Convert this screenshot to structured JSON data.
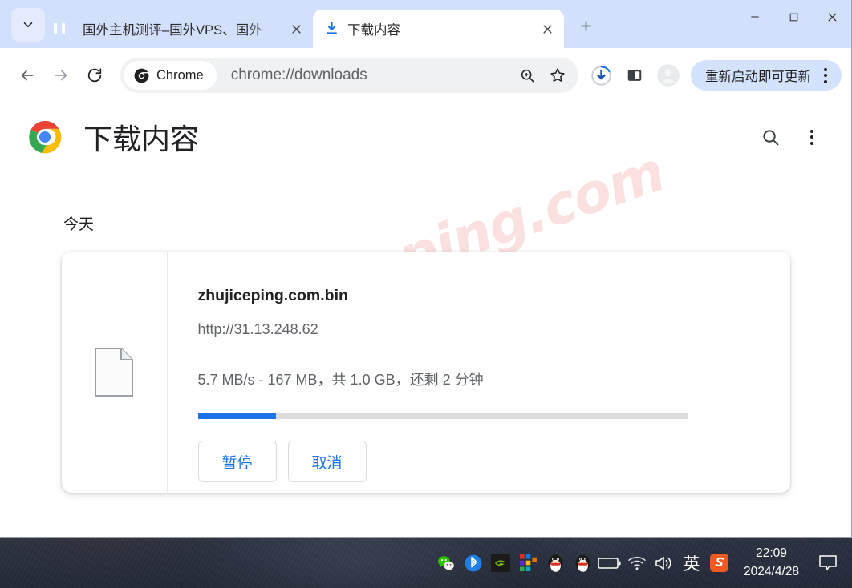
{
  "window": {
    "tab_search_icon": "chevron-down-icon",
    "tabs": [
      {
        "title": "国外主机测评–国外VPS、国外",
        "favicon": "site-favicon",
        "active": false
      },
      {
        "title": "下载内容",
        "favicon": "download-icon",
        "active": true
      }
    ],
    "new_tab_label": "+",
    "controls": {
      "minimize": "minimize-icon",
      "maximize": "maximize-icon",
      "close": "close-icon"
    }
  },
  "toolbar": {
    "back_icon": "back-arrow-icon",
    "forward_icon": "forward-arrow-icon",
    "reload_icon": "reload-icon",
    "chip_label": "Chrome",
    "url": "chrome://downloads",
    "zoom_icon": "zoom-in-icon",
    "bookmark_icon": "star-icon",
    "downloads_icon": "download-progress-icon",
    "side_panel_icon": "side-panel-icon",
    "profile_icon": "avatar-icon",
    "update_label": "重新启动即可更新",
    "menu_icon": "three-dot-menu-icon"
  },
  "page": {
    "logo": "chrome-logo",
    "title": "下载内容",
    "search_icon": "search-icon",
    "menu_icon": "three-dot-menu-icon",
    "watermark": "zhujiceping.com",
    "date_group": "今天",
    "download": {
      "file_icon": "document-file-icon",
      "name": "zhujiceping.com.bin",
      "url": "http://31.13.248.62",
      "status": "5.7 MB/s - 167 MB，共 1.0 GB，还剩 2 分钟",
      "progress_percent": 16,
      "pause_label": "暂停",
      "cancel_label": "取消"
    }
  },
  "taskbar": {
    "tray_icons": [
      "wechat-icon",
      "bluetooth-icon",
      "nvidia-icon",
      "app-grid-icon",
      "qq-icon",
      "qq-icon",
      "battery-icon",
      "wifi-icon",
      "volume-icon"
    ],
    "ime_label": "英",
    "sogou_icon": "sogou-input-icon",
    "time": "22:09",
    "date": "2024/4/28",
    "notification_icon": "notification-icon"
  },
  "colors": {
    "accent_blue": "#1a73e8",
    "tabstrip_blue": "#d2e0fb",
    "update_pill_blue": "#d3e3fd",
    "watermark_pink": "#fbe0e0"
  }
}
